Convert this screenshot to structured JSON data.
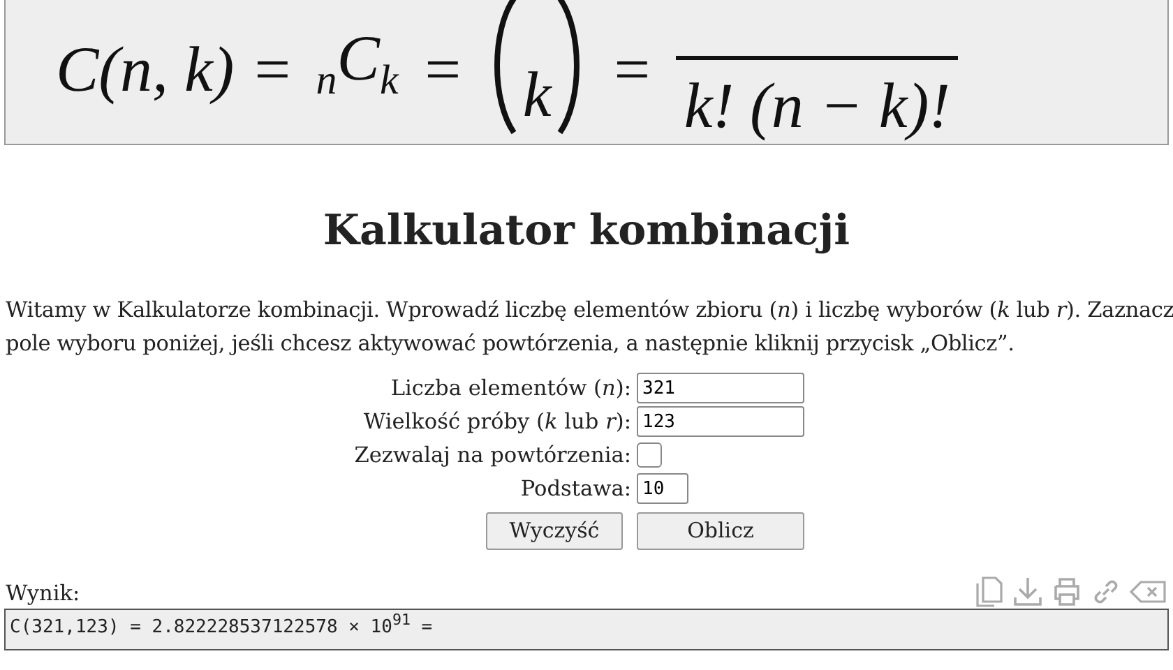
{
  "formula": {
    "lhs": "C(n, k) =",
    "sub_left": "n",
    "letter": "C",
    "sub_right": "k",
    "eq1": "=",
    "binom_bottom": "k",
    "eq2": "=",
    "denominator": "k! (n − k)!"
  },
  "title": "Kalkulator kombinacji",
  "intro": "Witamy w Kalkulatorze kombinacji. Wprowadź liczbę elementów zbioru (*n*) i liczbę wyborów (*k* lub *r*). Zaznacz pole wyboru poniżej, jeśli chcesz aktywować powtórzenia, a następnie kliknij przycisk „Oblicz”.",
  "fields": [
    {
      "kind": "text",
      "label": "Liczba elementów (*n*):",
      "value": "321"
    },
    {
      "kind": "text",
      "label": "Wielkość próby (*k* lub *r*):",
      "value": "123"
    },
    {
      "kind": "checkbox",
      "label": "Zezwalaj na powtórzenia:",
      "checked": false
    },
    {
      "kind": "short",
      "label": "Podstawa:",
      "value": "10"
    }
  ],
  "buttons": [
    "Wyczyść",
    "Oblicz"
  ],
  "result": {
    "label": "Wynik:",
    "text": "C(321,123) = 2.822228537122578 × 10$^{91}$ ="
  }
}
